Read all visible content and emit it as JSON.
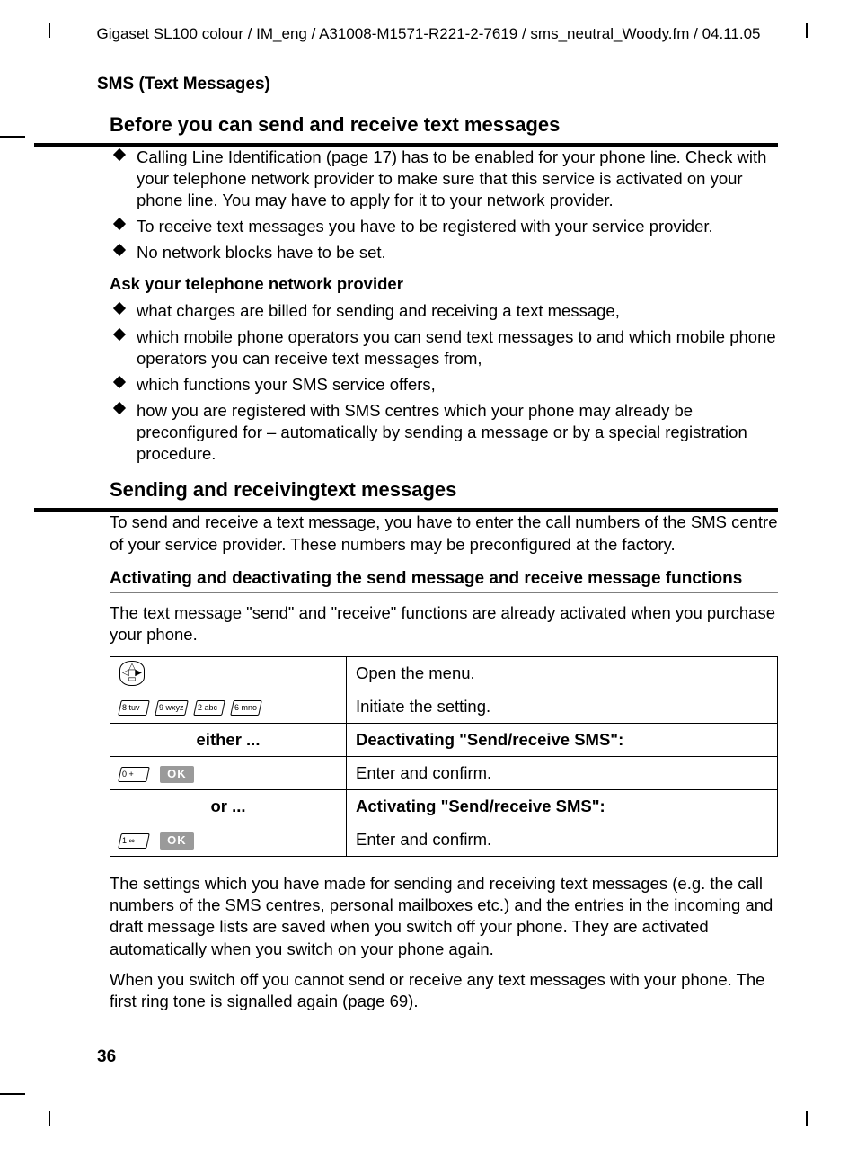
{
  "header": "Gigaset SL100 colour / IM_eng / A31008-M1571-R221-2-7619 / sms_neutral_Woody.fm / 04.11.05",
  "section_label": "SMS (Text Messages)",
  "h1a": "Before you can send and receive text messages",
  "bullets_a": [
    "Calling Line Identification (page 17) has to be enabled for your phone line. Check with your telephone network provider to make sure that this service is activated on your phone line. You may have to apply for it to your network provider.",
    "To receive text messages you have to be registered with your service provider.",
    "No network blocks have to be set."
  ],
  "ask_sub": "Ask your telephone network provider",
  "bullets_b": [
    "what charges are billed for sending and receiving a text message,",
    "which mobile phone operators you can send text messages to and which mobile phone operators you can receive text messages from,",
    "which functions your SMS service offers,",
    "how you are registered with SMS centres which your phone may already be preconfigured for – automatically by sending a message or by a special registration procedure."
  ],
  "h1b": "Sending and receivingtext messages",
  "para_intro": "To send and receive a text message, you have to enter the call numbers of the SMS centre of your service provider. These numbers may be preconfigured at the factory.",
  "h2": "Activating and deactivating the send message and receive message functions",
  "para_intro2": "The text message \"send\" and \"receive\" functions are already activated when you purchase your phone.",
  "table": {
    "r1": {
      "desc": "Open the menu."
    },
    "r2": {
      "keys": [
        "8 tuv",
        "9 wxyz",
        "2 abc",
        "6 mno"
      ],
      "desc": "Initiate the setting."
    },
    "r3": {
      "left": "either ...",
      "right": "Deactivating \"Send/receive SMS\":"
    },
    "r4": {
      "key": "0 +",
      "ok": "OK",
      "desc": "Enter and confirm."
    },
    "r5": {
      "left": "or ...",
      "right": "Activating \"Send/receive SMS\":"
    },
    "r6": {
      "key": "1 ∞",
      "ok": "OK",
      "desc": "Enter and confirm."
    }
  },
  "para_after1": "The settings which you have made for sending and receiving text messages (e.g. the call numbers of the SMS centres, personal mailboxes etc.) and the entries in the incoming and draft message lists are saved when you switch off your phone. They are activated automatically when you switch on your phone again.",
  "para_after2": "When you switch off you cannot send or receive any text messages with your phone. The first ring tone is signalled again (page 69).",
  "page_number": "36"
}
